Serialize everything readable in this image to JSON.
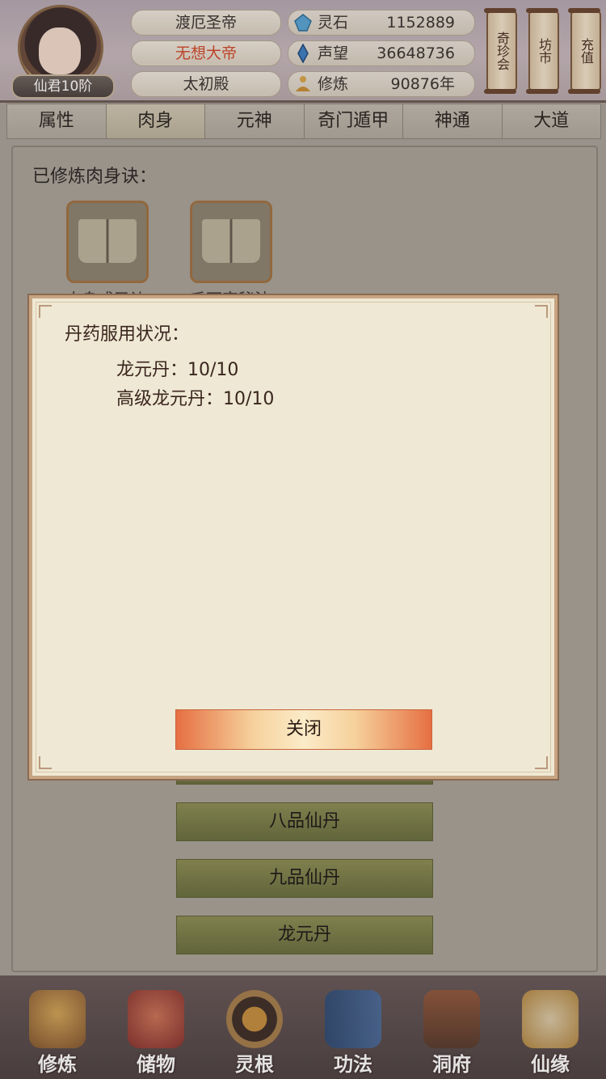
{
  "header": {
    "rank": "仙君10阶",
    "info": [
      "渡厄圣帝",
      "无想大帝",
      "太初殿"
    ],
    "resources": [
      {
        "label": "灵石",
        "value": "1152889",
        "icon": "spirit-stone-icon"
      },
      {
        "label": "声望",
        "value": "36648736",
        "icon": "prestige-crystal-icon"
      },
      {
        "label": "修炼",
        "value": "90876年",
        "icon": "meditation-icon"
      }
    ],
    "scroll_buttons": [
      "奇珍会",
      "坊市",
      "充值"
    ]
  },
  "tabs": [
    "属性",
    "肉身",
    "元神",
    "奇门遁甲",
    "神通",
    "大道"
  ],
  "content": {
    "section_title": "已修炼肉身诀：",
    "books": [
      "肉身成圣诀",
      "千面宗秘法"
    ],
    "pill_buttons": [
      "八品仙丹",
      "九品仙丹",
      "龙元丹"
    ]
  },
  "modal": {
    "title": "丹药服用状况：",
    "lines": [
      "龙元丹：10/10",
      "高级龙元丹：10/10"
    ],
    "close_label": "关闭"
  },
  "bottom_nav": [
    "修炼",
    "储物",
    "灵根",
    "功法",
    "洞府",
    "仙缘"
  ],
  "colors": {
    "highlight": "#d24b2d",
    "modal_bg": "#efe8d4",
    "pill_green": "#7a7f48",
    "close_orange": "#e66f42"
  }
}
